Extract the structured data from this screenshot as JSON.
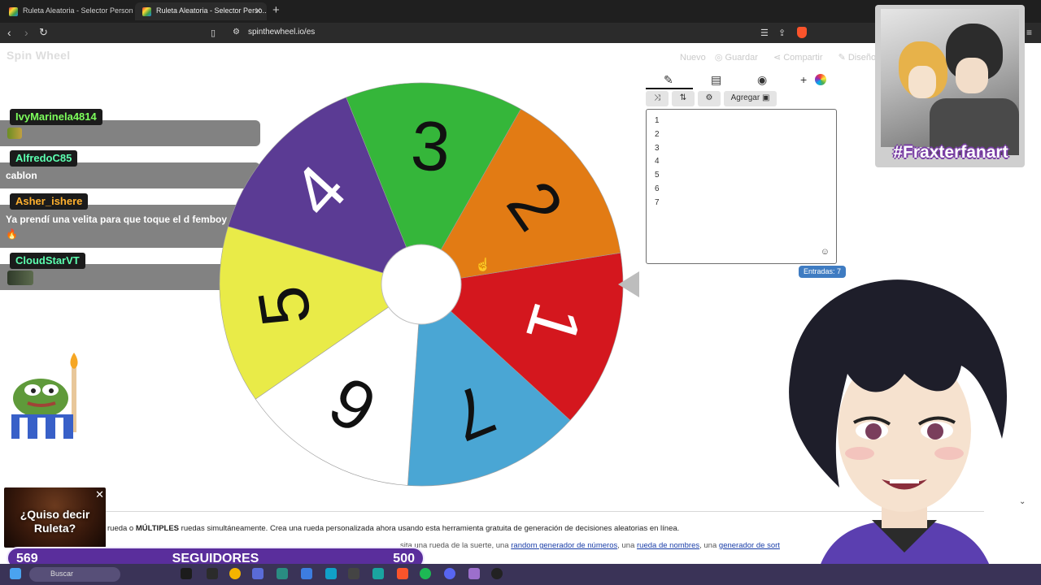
{
  "browser": {
    "tabs": [
      {
        "title": "Ruleta Aleatoria - Selector Personaliz..."
      },
      {
        "title": "Ruleta Aleatoria - Selector Perso..."
      }
    ],
    "new_tab": "+",
    "url": "spinthewheel.io/es"
  },
  "header": {
    "logo": "Spin Wheel",
    "links": [
      "Nuevo",
      "Guardar",
      "Compartir",
      "Diseño"
    ]
  },
  "chat": [
    {
      "user": "IvyMarinela4814",
      "color": "#7dff5c",
      "text": ""
    },
    {
      "user": "AlfredoC85",
      "color": "#5cffb0",
      "text": "cablon"
    },
    {
      "user": "Asher_ishere",
      "color": "#ffb02e",
      "text": "Ya prendí una velita para que toque el d femboy"
    },
    {
      "user": "CloudStarVT",
      "color": "#5cffb0",
      "text": ""
    }
  ],
  "wheel": {
    "segments": [
      {
        "label": "1",
        "color": "#d4171e",
        "text_color": "#ffffff"
      },
      {
        "label": "7",
        "color": "#4aa6d4",
        "text_color": "#111111"
      },
      {
        "label": "6",
        "color": "#ffffff",
        "text_color": "#111111"
      },
      {
        "label": "5",
        "color": "#e9eb48",
        "text_color": "#111111"
      },
      {
        "label": "4",
        "color": "#5b3b94",
        "text_color": "#ffffff"
      },
      {
        "label": "3",
        "color": "#35b63a",
        "text_color": "#111111"
      },
      {
        "label": "2",
        "color": "#e27b14",
        "text_color": "#111111"
      }
    ]
  },
  "panel": {
    "add_button": "Agregar",
    "entries": [
      "1",
      "2",
      "3",
      "4",
      "5",
      "6",
      "7"
    ],
    "entries_count": "Entradas: 7"
  },
  "fanart": {
    "tag": "#Fraxterfanart"
  },
  "page_text": {
    "line1_pre": "rueda o ",
    "line1_bold": "MÚLTIPLES",
    "line1_post": " ruedas simultáneamente. Crea una rueda personalizada ahora usando esta herramienta gratuita de generación de decisiones aleatorias en línea.",
    "line2_pre": "sita una rueda de la suerte, una ",
    "link1": "random generador de números",
    "line2_mid": ", una ",
    "link2": "rueda de nombres",
    "line2_mid2": ", una ",
    "link3": "generador de sort"
  },
  "ad": {
    "text": "¿Quiso decir Ruleta?",
    "close": "✕"
  },
  "goal": {
    "current": "569",
    "label": "SEGUIDORES",
    "target": "500"
  },
  "taskbar": {
    "search_placeholder": "Buscar"
  }
}
